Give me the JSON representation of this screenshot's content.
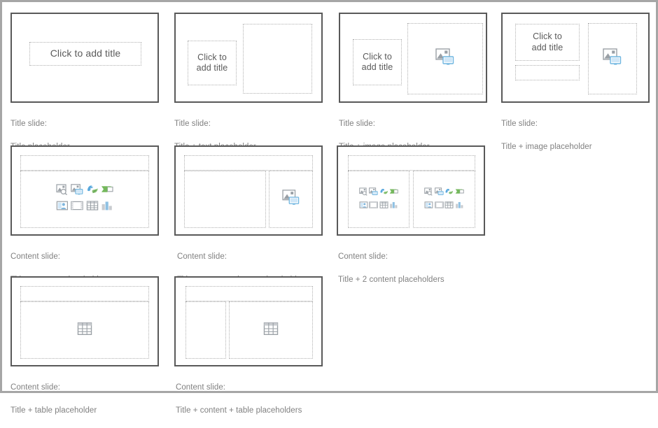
{
  "page": {
    "background_color": "#ffffff",
    "border_color": "#a6a6a6",
    "slide_border_color": "#595959",
    "placeholder_border_color": "#b0b0b0",
    "caption_color": "#808080",
    "title_text_color": "#5a5a5a",
    "icon_gray": "#9aa0a6",
    "icon_blue": "#a9cdeb",
    "icon_green": "#8cc07a"
  },
  "title_prompt": "Click to add title",
  "layouts": [
    {
      "id": "title-placeholder",
      "caption": "Title slide:\nTitle placeholder",
      "caption_line1": "Title slide:",
      "caption_line2": "Title placeholder",
      "kind": "title",
      "title_text": "Click to add title"
    },
    {
      "id": "title-text-placeholder",
      "caption": "Title slide:\nTitle + text placeholder",
      "caption_line1": "Title slide:",
      "caption_line2": "Title + text placeholder",
      "kind": "title-text",
      "title_text": "Click to\nadd title"
    },
    {
      "id": "title-image-placeholder",
      "caption": "Title slide:\nTitle + image placeholder",
      "caption_line1": "Title slide:",
      "caption_line2": "Title + image placeholder",
      "kind": "title-image",
      "title_text": "Click to\nadd title",
      "icons": [
        "picture-icon"
      ]
    },
    {
      "id": "title-subtitle-image-placeholder",
      "caption": "Title slide:\nTitle + image placeholder",
      "caption_line1": "Title slide:",
      "caption_line2": "Title + image placeholder",
      "kind": "title-sub-image",
      "title_text": "Click to\nadd title",
      "icons": [
        "picture-icon"
      ]
    },
    {
      "id": "content-placeholder",
      "caption": "Content slide:\nTitle + content placeholder",
      "caption_line1": "Content slide:",
      "caption_line2": "Title + content placeholder",
      "kind": "content",
      "icons": [
        "stock-image-icon",
        "picture-device-icon",
        "icons-icon",
        "smartart-icon",
        "people-image-icon",
        "video-icon",
        "table-icon",
        "chart-icon"
      ]
    },
    {
      "id": "content-image-placeholder",
      "caption": "Content slide:\nTitle + content + image placeholder",
      "caption_line1": "Content slide:",
      "caption_line2": "Title + content + image placeholder",
      "kind": "content-image",
      "icons": [
        "picture-icon"
      ]
    },
    {
      "id": "two-content-placeholders",
      "caption": "Content slide:\nTitle + 2 content placeholders",
      "caption_line1": "Content slide:",
      "caption_line2": "Title + 2 content placeholders",
      "kind": "two-content",
      "icons": [
        "stock-image-icon",
        "picture-device-icon",
        "icons-icon",
        "smartart-icon",
        "people-image-icon",
        "video-icon",
        "table-icon",
        "chart-icon"
      ]
    },
    {
      "id": "table-placeholder",
      "caption": "Content slide:\nTitle + table placeholder",
      "caption_line1": "Content slide:",
      "caption_line2": "Title + table placeholder",
      "kind": "table",
      "icons": [
        "table-icon"
      ]
    },
    {
      "id": "content-table-placeholders",
      "caption": "Content slide:\nTitle + content + table placeholders",
      "caption_line1": "Content slide:",
      "caption_line2": "Title + content + table placeholders",
      "kind": "content-table",
      "icons": [
        "table-icon"
      ]
    }
  ]
}
